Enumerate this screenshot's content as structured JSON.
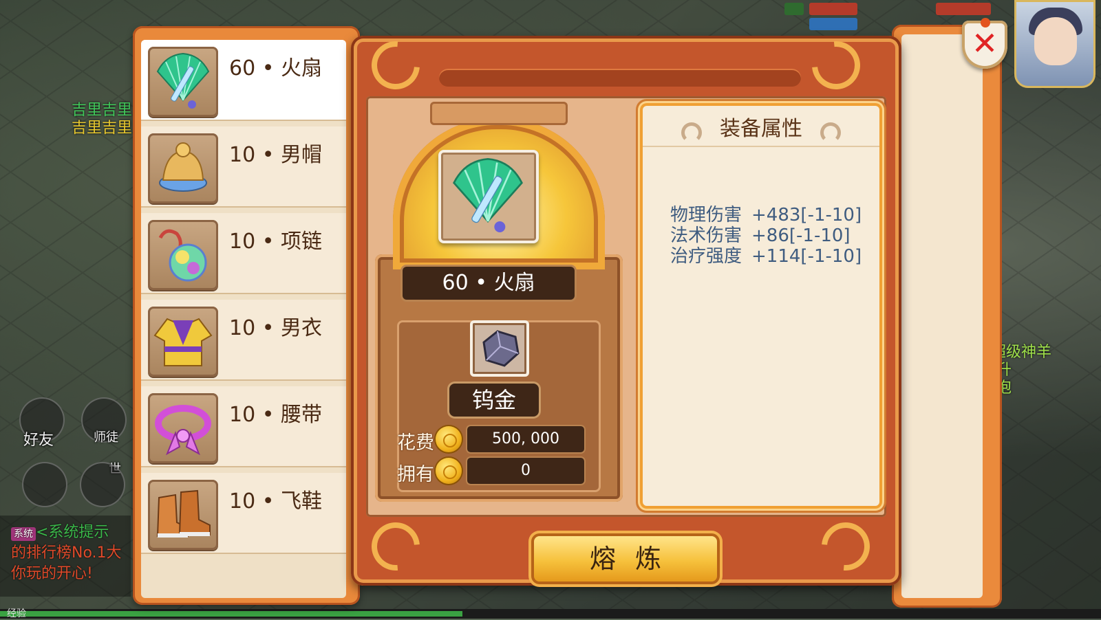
{
  "background": {
    "npc_name_1": "吉里吉里",
    "npc_name_2": "吉里吉里",
    "friends_label": "好友",
    "master_label": "师徒",
    "world_label": "世",
    "right_text_1": "超级神羊",
    "right_text_2": "提升",
    "right_text_3": "泡泡",
    "chat": {
      "tag": "系统",
      "line1": "<系统提示",
      "line2": "的排行榜No.1大",
      "line3": "你玩的开心!"
    },
    "xp_label": "经验",
    "xp_progress": 0.42
  },
  "equipment_list": [
    {
      "level": "60",
      "name": "火扇",
      "icon": "fan-icon",
      "selected": true
    },
    {
      "level": "10",
      "name": "男帽",
      "icon": "hat-icon",
      "selected": false
    },
    {
      "level": "10",
      "name": "项链",
      "icon": "necklace-icon",
      "selected": false
    },
    {
      "level": "10",
      "name": "男衣",
      "icon": "robe-icon",
      "selected": false
    },
    {
      "level": "10",
      "name": "腰带",
      "icon": "belt-icon",
      "selected": false
    },
    {
      "level": "10",
      "name": "飞鞋",
      "icon": "boots-icon",
      "selected": false
    }
  ],
  "selected_item": {
    "label": "60 • 火扇",
    "icon": "fan-icon"
  },
  "material": {
    "name": "钨金",
    "icon": "tungsten-ore-icon"
  },
  "cost": {
    "cost_label": "花费",
    "cost_value": "500, 000",
    "own_label": "拥有",
    "own_value": "0",
    "currency_icon": "gold-coin-icon"
  },
  "attributes": {
    "title": "装备属性",
    "lines": [
      {
        "name": "物理伤害",
        "value": "+483[-1-10]"
      },
      {
        "name": "法术伤害",
        "value": "+86[-1-10]"
      },
      {
        "name": "治疗强度",
        "value": "+114[-1-10]"
      }
    ]
  },
  "smelt_button": "熔炼",
  "close_icon": "close-icon",
  "colors": {
    "panel_orange": "#e9893b",
    "attr_text": "#3f5c80",
    "close_red": "#e02424",
    "button_gold": "#f6c13c"
  }
}
